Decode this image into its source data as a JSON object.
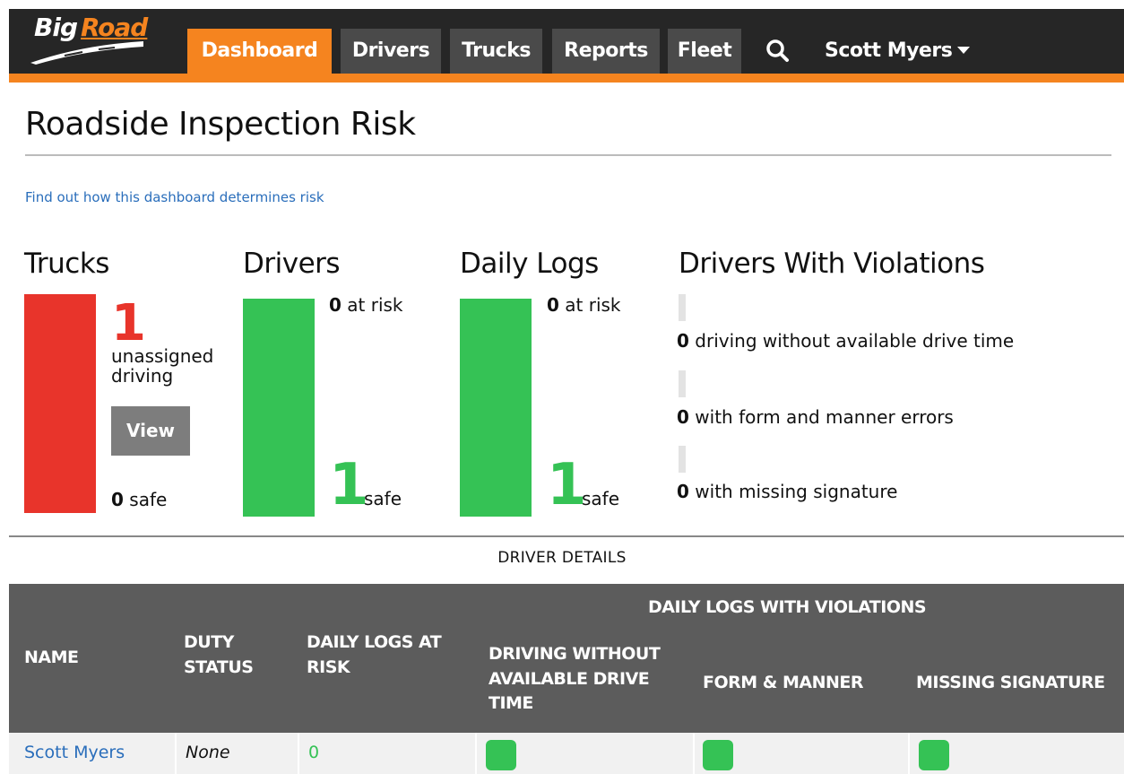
{
  "app": {
    "logo": {
      "part1": "Big",
      "part2": "Road"
    }
  },
  "nav": {
    "tabs": [
      {
        "label": "Dashboard",
        "active": true
      },
      {
        "label": "Drivers",
        "active": false
      },
      {
        "label": "Trucks",
        "active": false
      },
      {
        "label": "Reports",
        "active": false
      },
      {
        "label": "Fleet",
        "active": false
      }
    ],
    "search_icon": "search-icon",
    "user_name": "Scott Myers"
  },
  "page": {
    "title": "Roadside Inspection Risk",
    "help_link": "Find out how this dashboard determines risk"
  },
  "summary": {
    "trucks": {
      "title": "Trucks",
      "unassigned_count": "1",
      "unassigned_label_1": "unassigned",
      "unassigned_label_2": "driving",
      "view_button": "View",
      "safe_count": "0",
      "safe_label": "safe",
      "bar_color": "#e8342b"
    },
    "drivers": {
      "title": "Drivers",
      "at_risk_count": "0",
      "at_risk_label": "at risk",
      "safe_count": "1",
      "safe_label": "safe",
      "bar_color": "#35c255"
    },
    "daily_logs": {
      "title": "Daily Logs",
      "at_risk_count": "0",
      "at_risk_label": "at risk",
      "safe_count": "1",
      "safe_label": "safe",
      "bar_color": "#35c255"
    },
    "violations": {
      "title": "Drivers With Violations",
      "items": [
        {
          "count": "0",
          "label": "driving without available drive time"
        },
        {
          "count": "0",
          "label": "with form and manner errors"
        },
        {
          "count": "0",
          "label": "with missing signature"
        }
      ]
    }
  },
  "driver_details": {
    "heading": "DRIVER DETAILS",
    "group_header": "DAILY LOGS WITH VIOLATIONS",
    "columns": {
      "name": "NAME",
      "duty_1": "DUTY",
      "duty_2": "STATUS",
      "logs_1": "DAILY LOGS AT",
      "logs_2": "RISK",
      "drive_1": "DRIVING WITHOUT",
      "drive_2": "AVAILABLE DRIVE",
      "drive_3": "TIME",
      "form": "FORM & MANNER",
      "sig": "MISSING SIGNATURE"
    },
    "rows": [
      {
        "name": "Scott Myers",
        "duty_status": "None",
        "daily_logs_at_risk": "0",
        "status_color": "#35c255"
      }
    ]
  },
  "colors": {
    "accent": "#f5841f",
    "nav_bg": "#262626",
    "tab_bg": "#4a4a4a",
    "risk_red": "#e8342b",
    "safe_green": "#35c255",
    "link_blue": "#2a6ebb"
  }
}
